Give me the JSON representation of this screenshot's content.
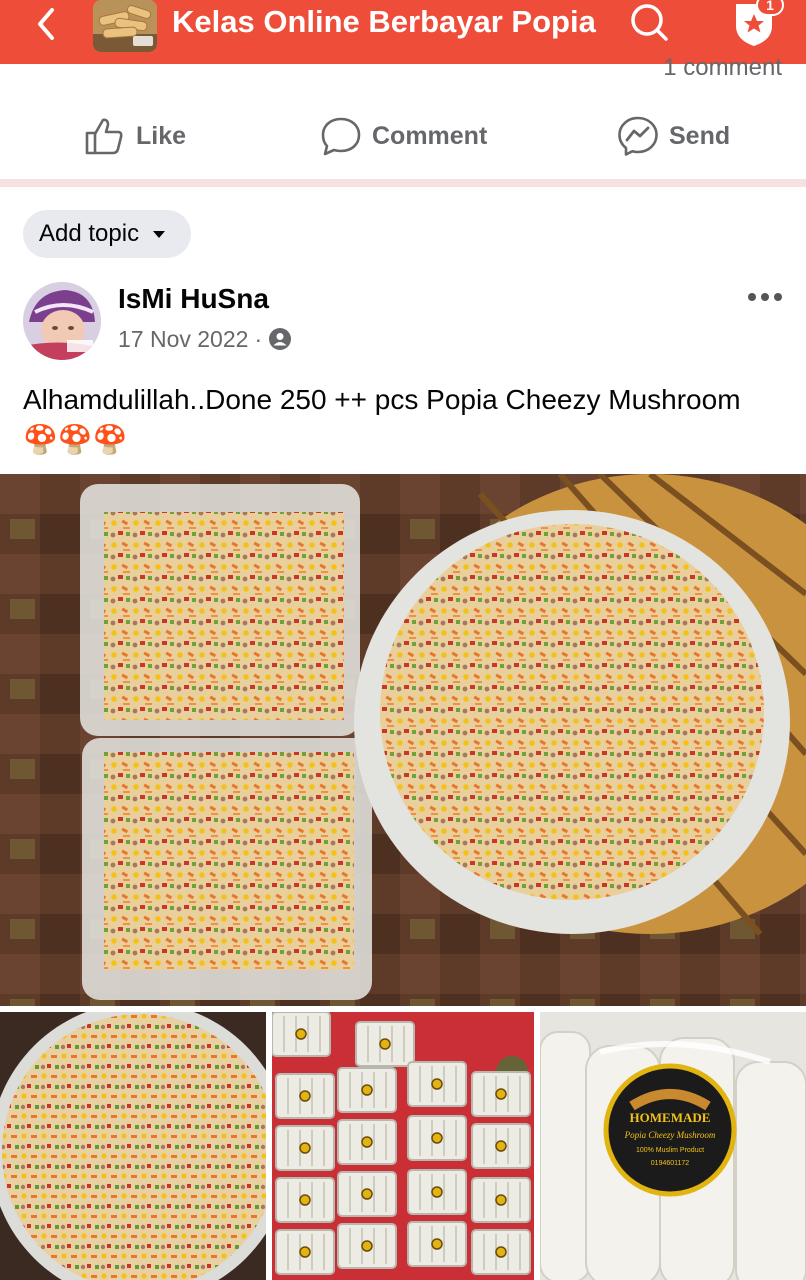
{
  "topbar": {
    "title": "Kelas Online Berbayar Popia",
    "notification_count": "1",
    "back_icon": "chevron-left-icon",
    "search_icon": "search-icon",
    "notification_icon": "shield-star-icon",
    "accent_color": "#EE4D3A"
  },
  "previous_post": {
    "comment_count": "1 comment",
    "like_label": "Like",
    "comment_label": "Comment",
    "send_label": "Send"
  },
  "post": {
    "topic_label": "Add topic",
    "author": "IsMi HuSna",
    "date": "17 Nov 2022",
    "date_separator": "·",
    "audience_icon": "group-audience-icon",
    "text": "Alhamdulillah..Done 250 ++ pcs Popia Cheezy Mushroom 🍄🍄🍄",
    "photos": [
      {
        "description": "containers of popia filling",
        "name": "photo-filling-containers"
      },
      {
        "description": "bowl of popia filling",
        "name": "photo-filling-bowl"
      },
      {
        "description": "packed popia in boxes",
        "name": "photo-packed-boxes"
      },
      {
        "description": "popia with label",
        "name": "photo-labelled-popia"
      }
    ],
    "label_sticker": {
      "line1": "HOMEMADE",
      "line2": "Popia Cheezy Mushroom",
      "line3": "100% Muslim Product",
      "line4": "0194601172"
    }
  }
}
